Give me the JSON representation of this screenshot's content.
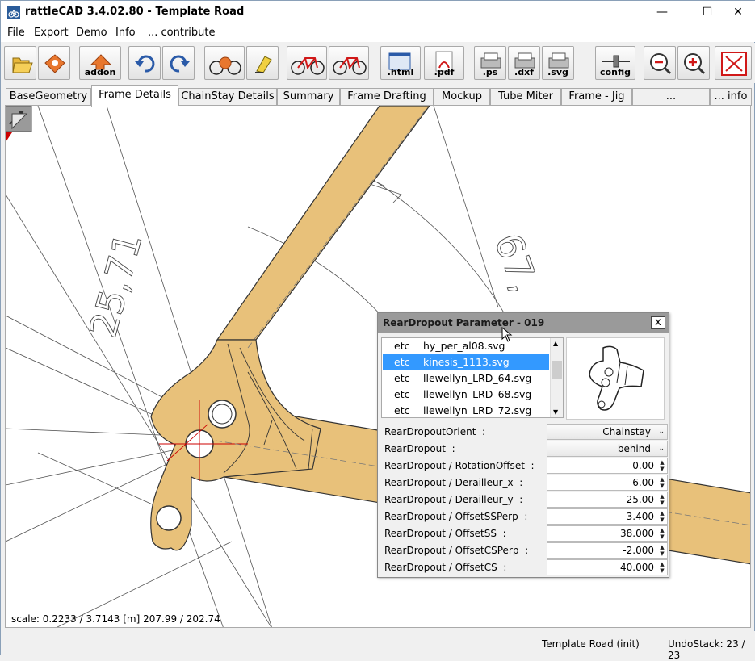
{
  "window": {
    "title": "rattleCAD  3.4.02.80 - Template Road",
    "minimize_glyph": "—",
    "maximize_glyph": "☐",
    "close_glyph": "✕"
  },
  "menu": [
    "File",
    "Export",
    "Demo",
    "Info",
    "... contribute"
  ],
  "toolbar": {
    "addon_label": "addon",
    "html_label": ".html",
    "pdf_label": ".pdf",
    "ps_label": ".ps",
    "dxf_label": ".dxf",
    "svg_label": ".svg",
    "config_label": "config",
    "icons": [
      "open-folder-icon",
      "open-template-icon",
      "addon-icon",
      "undo-icon",
      "redo-icon",
      "rendering-icon",
      "clear-icon",
      "bike-icon-1",
      "bike-icon-2",
      "html-export-icon",
      "pdf-export-icon",
      "ps-export-icon",
      "dxf-export-icon",
      "svg-export-icon",
      "config-icon",
      "zoom-out-icon",
      "zoom-in-icon",
      "fit-view-icon"
    ]
  },
  "tabs": [
    "BaseGeometry",
    "Frame Details",
    "ChainStay Details",
    "Summary",
    "Frame Drafting",
    "Mockup",
    "Tube Miter",
    "Frame - Jig",
    "... Components",
    "... info"
  ],
  "active_tab": "Frame Details",
  "canvas": {
    "dim_label_1": "25,71",
    "dim_label_2": "67,",
    "scale_text": "scale: 0.2233 / 3.7143  [m]  207.99 / 202.74"
  },
  "dialog": {
    "title": "RearDropout Parameter - 019",
    "close_glyph": "x",
    "files": [
      {
        "type": "etc",
        "name": "hy_per_al08.svg",
        "selected": false
      },
      {
        "type": "etc",
        "name": "kinesis_1113.svg",
        "selected": true
      },
      {
        "type": "etc",
        "name": "llewellyn_LRD_64.svg",
        "selected": false
      },
      {
        "type": "etc",
        "name": "llewellyn_LRD_68.svg",
        "selected": false
      },
      {
        "type": "etc",
        "name": "llewellyn_LRD_72.svg",
        "selected": false
      }
    ],
    "params": [
      {
        "label": "RearDropoutOrient  :",
        "value": "Chainstay",
        "kind": "combo"
      },
      {
        "label": "RearDropout  :",
        "value": "behind",
        "kind": "combo"
      },
      {
        "label": "RearDropout / RotationOffset  :",
        "value": "0.00",
        "kind": "spin"
      },
      {
        "label": "RearDropout / Derailleur_x  :",
        "value": "6.00",
        "kind": "spin"
      },
      {
        "label": "RearDropout / Derailleur_y  :",
        "value": "25.00",
        "kind": "spin"
      },
      {
        "label": "RearDropout / OffsetSSPerp  :",
        "value": "-3.400",
        "kind": "spin"
      },
      {
        "label": "RearDropout / OffsetSS  :",
        "value": "38.000",
        "kind": "spin"
      },
      {
        "label": "RearDropout / OffsetCSPerp  :",
        "value": "-2.000",
        "kind": "spin"
      },
      {
        "label": "RearDropout / OffsetCS  :",
        "value": "40.000",
        "kind": "spin"
      }
    ]
  },
  "status": {
    "project": "Template Road (init)",
    "undo": "UndoStack: 23 / 23"
  },
  "colors": {
    "tube_fill": "#e8c17a",
    "selection": "#3399ff",
    "dialog_header": "#9a9a9a",
    "crosshair": "#cc0000"
  }
}
